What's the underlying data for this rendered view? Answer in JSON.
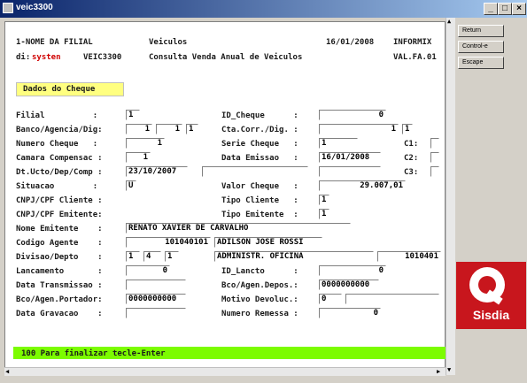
{
  "window": {
    "title": "veic3300"
  },
  "header": {
    "branch": "1-NOME DA FILIAL",
    "module": "Veiculos",
    "date": "16/01/2008",
    "db": "INFORMIX",
    "dir_label": "di:",
    "dir_value": "systen",
    "program": "VEIC3300",
    "description": "Consulta Venda Anual de Veiculos",
    "version": "VAL.FA.01"
  },
  "section_title": "Dados do Cheque",
  "labels": {
    "filial": "Filial          :",
    "banco": "Banco/Agencia/Dig:",
    "numero_cheque": "Numero Cheque   :",
    "camara": "Camara Compensac :",
    "dt_ucto": "Dt.Ucto/Dep/Comp :",
    "situacao": "Situacao        :",
    "cnpj_cliente": "CNPJ/CPF Cliente :",
    "cnpj_emitente": "CNPJ/CPF Emitente:",
    "nome_emitente": "Nome Emitente    :",
    "codigo_agente": "Codigo Agente    :",
    "divisao": "Divisao/Depto    :",
    "lancamento": "Lancamento       :",
    "data_transmissao": "Data Transmissao :",
    "bco_portador": "Bco/Agen.Portador:",
    "data_gravacao": "Data Gravacao    :",
    "id_cheque": "ID_Cheque      :",
    "cta_corr": "Cta.Corr./Dig. :",
    "serie_cheque": "Serie Cheque   :",
    "data_emissao": "Data Emissao   :",
    "valor_cheque": "Valor Cheque   :",
    "tipo_cliente": "Tipo Cliente   :",
    "tipo_emitente": "Tipo Emitente  :",
    "id_lancto": "ID_Lancto      :",
    "bco_depos": "Bco/Agen.Depos.:",
    "motivo": "Motivo Devoluc.:",
    "numero_remessa": "Numero Remessa :",
    "c1": "C1:",
    "c2": "C2:",
    "c3": "C3:"
  },
  "values": {
    "filial": "1",
    "banco": "1",
    "agencia": "1",
    "dig": "1",
    "numero_cheque": "1",
    "camara": "1",
    "dt_ucto": "23/10/2007",
    "situacao": "U",
    "nome_emitente": "RENATO XAVIER DE CARVALHO",
    "codigo_agente": "101040101",
    "agente_nome": "ADILSON JOSE ROSSI",
    "divisao": "1",
    "depto": "4",
    "depto2": "1",
    "divisao_nome": "ADMINISTR. OFICINA",
    "divisao_codigo": "1010401",
    "lancamento": "0",
    "bco_portador": "0000000000",
    "id_cheque": "0",
    "cta_corr": "1",
    "cta_dig": "1",
    "serie_cheque": "1",
    "data_emissao": "16/01/2008",
    "valor_cheque": "29.007,01",
    "tipo_cliente": "1",
    "tipo_emitente": "1",
    "id_lancto": "0",
    "bco_depos": "0000000000",
    "motivo": "0",
    "numero_remessa": "0"
  },
  "status_message": "100 Para finalizar tecle-Enter",
  "side_buttons": [
    "Return",
    "Control-e",
    "Escape"
  ],
  "logo_text": "Sisdia"
}
